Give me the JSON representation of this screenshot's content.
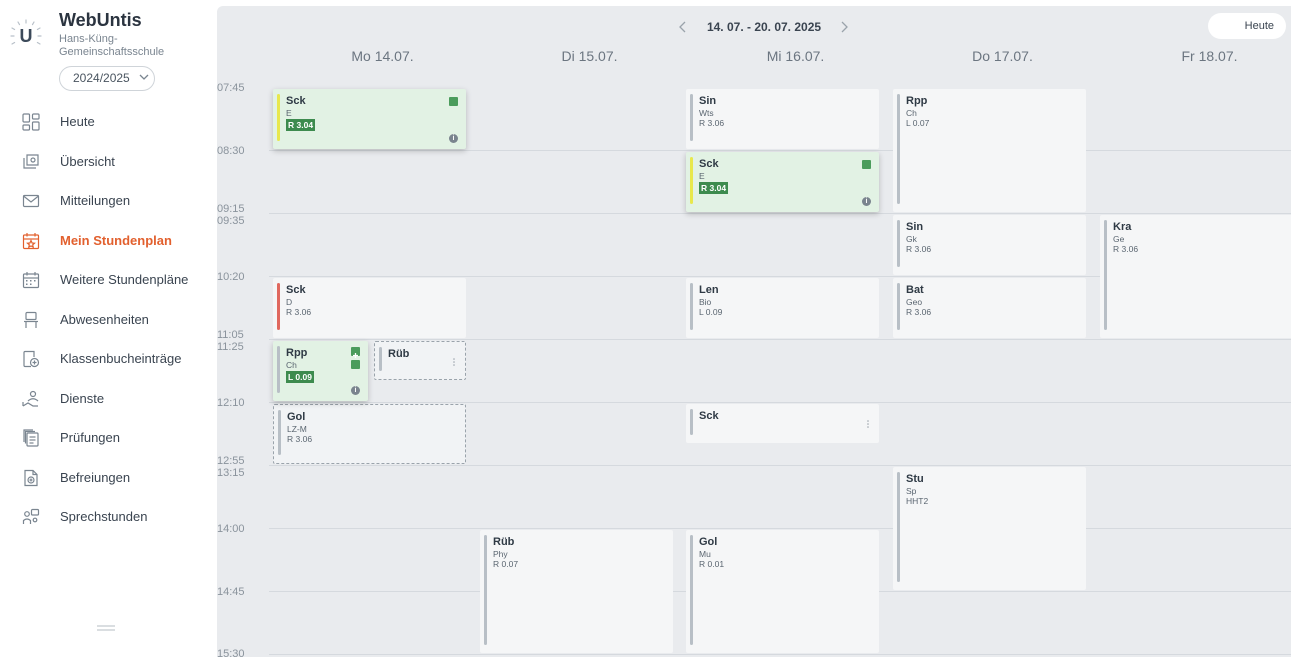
{
  "app": {
    "brand": "WebUntis",
    "logo_letter": "U",
    "school": "Hans-Küng-Gemeinschaftsschule",
    "school_year": "2024/2025"
  },
  "colors": {
    "accent": "#e2602e",
    "lesson_bg": "#f5f6f7",
    "changed_bg": "#e2f2e4",
    "room_changed": "#3d8b4e",
    "bar_default": "#b8bfc6",
    "bar_yellow": "#e8e84c",
    "bar_red": "#e0685e"
  },
  "sidebar": {
    "items": [
      {
        "label": "Heute",
        "icon": "dashboard-icon",
        "active": false
      },
      {
        "label": "Übersicht",
        "icon": "overview-icon",
        "active": false
      },
      {
        "label": "Mitteilungen",
        "icon": "mail-icon",
        "active": false
      },
      {
        "label": "Mein Stundenplan",
        "icon": "calendar-star-icon",
        "active": true
      },
      {
        "label": "Weitere Stundenpläne",
        "icon": "calendar-grid-icon",
        "active": false
      },
      {
        "label": "Abwesenheiten",
        "icon": "absence-icon",
        "active": false
      },
      {
        "label": "Klassenbucheinträge",
        "icon": "classbook-add-icon",
        "active": false
      },
      {
        "label": "Dienste",
        "icon": "duty-icon",
        "active": false
      },
      {
        "label": "Prüfungen",
        "icon": "exams-icon",
        "active": false
      },
      {
        "label": "Befreiungen",
        "icon": "exemption-icon",
        "active": false
      },
      {
        "label": "Sprechstunden",
        "icon": "consultation-icon",
        "active": false
      }
    ]
  },
  "timetable": {
    "week_label": "14. 07. - 20. 07. 2025",
    "today_button": "Heute",
    "days": [
      "Mo 14.07.",
      "Di 15.07.",
      "Mi 16.07.",
      "Do 17.07.",
      "Fr 18.07."
    ],
    "times": [
      "07:45",
      "08:30",
      "09:15",
      "09:35",
      "10:20",
      "11:05",
      "11:25",
      "12:10",
      "12:55",
      "13:15",
      "14:00",
      "14:45",
      "15:30"
    ],
    "lessons": [
      {
        "day": 0,
        "start": "07:45",
        "end": "08:30",
        "teacher": "Sck",
        "subject": "E",
        "room": "R 3.04",
        "room_changed": true,
        "status": "changed",
        "bar": "yellow",
        "marker": "square",
        "info": true
      },
      {
        "day": 2,
        "start": "07:45",
        "end": "08:30",
        "teacher": "Sin",
        "subject": "Wts",
        "room": "R 3.06",
        "status": "normal",
        "bar": "default"
      },
      {
        "day": 2,
        "start": "08:30",
        "end": "09:15",
        "teacher": "Sck",
        "subject": "E",
        "room": "R 3.04",
        "room_changed": true,
        "status": "changed",
        "bar": "yellow",
        "marker": "square",
        "info": true
      },
      {
        "day": 3,
        "start": "07:45",
        "end": "09:15",
        "teacher": "Rpp",
        "subject": "Ch",
        "room": "L 0.07",
        "status": "normal",
        "bar": "default"
      },
      {
        "day": 3,
        "start": "09:35",
        "end": "10:20",
        "teacher": "Sin",
        "subject": "Gk",
        "room": "R 3.06",
        "status": "normal",
        "bar": "default"
      },
      {
        "day": 4,
        "start": "09:35",
        "end": "11:05",
        "teacher": "Kra",
        "subject": "Ge",
        "room": "R 3.06",
        "status": "normal",
        "bar": "default"
      },
      {
        "day": 0,
        "start": "10:20",
        "end": "11:05",
        "teacher": "Sck",
        "subject": "D",
        "room": "R 3.06",
        "status": "normal",
        "bar": "red"
      },
      {
        "day": 2,
        "start": "10:20",
        "end": "11:05",
        "teacher": "Len",
        "subject": "Bio",
        "room": "L 0.09",
        "status": "normal",
        "bar": "default"
      },
      {
        "day": 3,
        "start": "10:20",
        "end": "11:05",
        "teacher": "Bat",
        "subject": "Geo",
        "room": "R 3.06",
        "status": "normal",
        "bar": "default"
      },
      {
        "day": 0,
        "start": "11:25",
        "end": "12:10",
        "teacher": "Rpp",
        "subject": "Ch",
        "room": "L 0.09",
        "room_changed": true,
        "status": "changed",
        "bar": "default",
        "marker": "square-plus",
        "info": true,
        "half": "left"
      },
      {
        "day": 0,
        "start": "11:25",
        "end": "11:55",
        "teacher": "Rüb",
        "status": "dashed",
        "bar": "default",
        "half": "right",
        "kebab": true
      },
      {
        "day": 0,
        "start": "12:10",
        "end": "12:55",
        "teacher": "Gol",
        "subject": "LZ-M",
        "room": "R 3.06",
        "status": "dashed",
        "bar": "default"
      },
      {
        "day": 2,
        "start": "12:10",
        "end": "12:40",
        "teacher": "Sck",
        "status": "normal",
        "bar": "default",
        "kebab": true
      },
      {
        "day": 3,
        "start": "13:15",
        "end": "14:45",
        "teacher": "Stu",
        "subject": "Sp",
        "room": "HHT2",
        "status": "normal",
        "bar": "default"
      },
      {
        "day": 1,
        "start": "14:00",
        "end": "15:30",
        "teacher": "Rüb",
        "subject": "Phy",
        "room": "R 0.07",
        "status": "normal",
        "bar": "default"
      },
      {
        "day": 2,
        "start": "14:00",
        "end": "15:30",
        "teacher": "Gol",
        "subject": "Mu",
        "room": "R 0.01",
        "status": "normal",
        "bar": "default"
      }
    ]
  }
}
